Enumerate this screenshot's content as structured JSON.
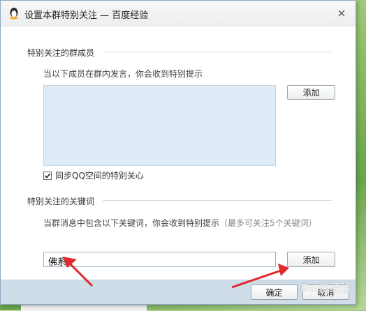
{
  "window": {
    "title": "设置本群特别关注 — 百度经验",
    "close_icon": "close-icon"
  },
  "members_section": {
    "title": "特别关注的群成员",
    "description": "当以下成员在群内发言，你会收到特别提示",
    "add_button": "添加",
    "list_items": [],
    "sync_checkbox": {
      "label": "同步QQ空间的特别关心",
      "checked": true
    }
  },
  "keywords_section": {
    "title": "特别关注的关键词",
    "description": "当群消息中包含以下关键词，你会收到特别提示",
    "hint": "（最多可关注5个关键词）",
    "input_value": "佛系",
    "add_button": "添加"
  },
  "footer": {
    "ok_button": "确定",
    "cancel_button": "取消"
  },
  "watermark": "Bai度经验",
  "colors": {
    "footer_bg": "#cfdde9",
    "listbox_bg": "#deebf6",
    "arrow": "#e0282d"
  }
}
